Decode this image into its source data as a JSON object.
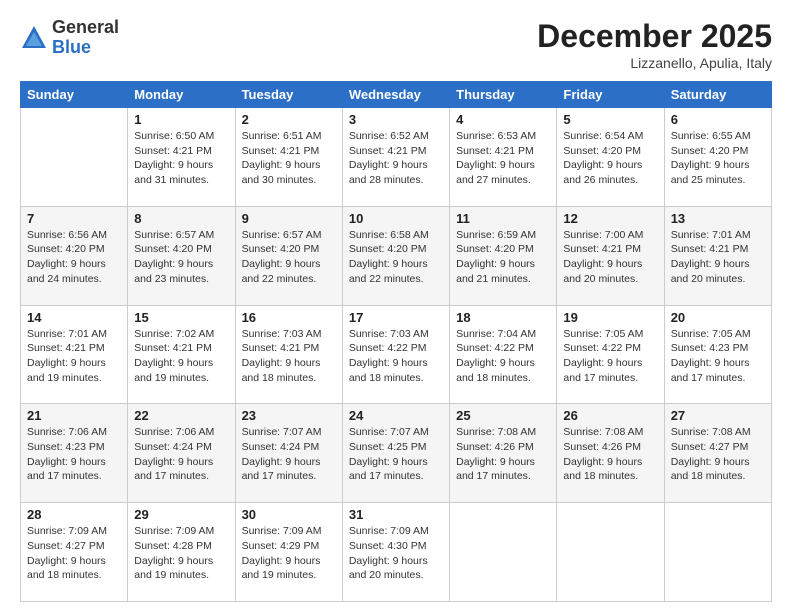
{
  "logo": {
    "general": "General",
    "blue": "Blue"
  },
  "header": {
    "month": "December 2025",
    "location": "Lizzanello, Apulia, Italy"
  },
  "weekdays": [
    "Sunday",
    "Monday",
    "Tuesday",
    "Wednesday",
    "Thursday",
    "Friday",
    "Saturday"
  ],
  "weeks": [
    [
      {
        "day": "",
        "info": ""
      },
      {
        "day": "1",
        "info": "Sunrise: 6:50 AM\nSunset: 4:21 PM\nDaylight: 9 hours\nand 31 minutes."
      },
      {
        "day": "2",
        "info": "Sunrise: 6:51 AM\nSunset: 4:21 PM\nDaylight: 9 hours\nand 30 minutes."
      },
      {
        "day": "3",
        "info": "Sunrise: 6:52 AM\nSunset: 4:21 PM\nDaylight: 9 hours\nand 28 minutes."
      },
      {
        "day": "4",
        "info": "Sunrise: 6:53 AM\nSunset: 4:21 PM\nDaylight: 9 hours\nand 27 minutes."
      },
      {
        "day": "5",
        "info": "Sunrise: 6:54 AM\nSunset: 4:20 PM\nDaylight: 9 hours\nand 26 minutes."
      },
      {
        "day": "6",
        "info": "Sunrise: 6:55 AM\nSunset: 4:20 PM\nDaylight: 9 hours\nand 25 minutes."
      }
    ],
    [
      {
        "day": "7",
        "info": "Sunrise: 6:56 AM\nSunset: 4:20 PM\nDaylight: 9 hours\nand 24 minutes."
      },
      {
        "day": "8",
        "info": "Sunrise: 6:57 AM\nSunset: 4:20 PM\nDaylight: 9 hours\nand 23 minutes."
      },
      {
        "day": "9",
        "info": "Sunrise: 6:57 AM\nSunset: 4:20 PM\nDaylight: 9 hours\nand 22 minutes."
      },
      {
        "day": "10",
        "info": "Sunrise: 6:58 AM\nSunset: 4:20 PM\nDaylight: 9 hours\nand 22 minutes."
      },
      {
        "day": "11",
        "info": "Sunrise: 6:59 AM\nSunset: 4:20 PM\nDaylight: 9 hours\nand 21 minutes."
      },
      {
        "day": "12",
        "info": "Sunrise: 7:00 AM\nSunset: 4:21 PM\nDaylight: 9 hours\nand 20 minutes."
      },
      {
        "day": "13",
        "info": "Sunrise: 7:01 AM\nSunset: 4:21 PM\nDaylight: 9 hours\nand 20 minutes."
      }
    ],
    [
      {
        "day": "14",
        "info": "Sunrise: 7:01 AM\nSunset: 4:21 PM\nDaylight: 9 hours\nand 19 minutes."
      },
      {
        "day": "15",
        "info": "Sunrise: 7:02 AM\nSunset: 4:21 PM\nDaylight: 9 hours\nand 19 minutes."
      },
      {
        "day": "16",
        "info": "Sunrise: 7:03 AM\nSunset: 4:21 PM\nDaylight: 9 hours\nand 18 minutes."
      },
      {
        "day": "17",
        "info": "Sunrise: 7:03 AM\nSunset: 4:22 PM\nDaylight: 9 hours\nand 18 minutes."
      },
      {
        "day": "18",
        "info": "Sunrise: 7:04 AM\nSunset: 4:22 PM\nDaylight: 9 hours\nand 18 minutes."
      },
      {
        "day": "19",
        "info": "Sunrise: 7:05 AM\nSunset: 4:22 PM\nDaylight: 9 hours\nand 17 minutes."
      },
      {
        "day": "20",
        "info": "Sunrise: 7:05 AM\nSunset: 4:23 PM\nDaylight: 9 hours\nand 17 minutes."
      }
    ],
    [
      {
        "day": "21",
        "info": "Sunrise: 7:06 AM\nSunset: 4:23 PM\nDaylight: 9 hours\nand 17 minutes."
      },
      {
        "day": "22",
        "info": "Sunrise: 7:06 AM\nSunset: 4:24 PM\nDaylight: 9 hours\nand 17 minutes."
      },
      {
        "day": "23",
        "info": "Sunrise: 7:07 AM\nSunset: 4:24 PM\nDaylight: 9 hours\nand 17 minutes."
      },
      {
        "day": "24",
        "info": "Sunrise: 7:07 AM\nSunset: 4:25 PM\nDaylight: 9 hours\nand 17 minutes."
      },
      {
        "day": "25",
        "info": "Sunrise: 7:08 AM\nSunset: 4:26 PM\nDaylight: 9 hours\nand 17 minutes."
      },
      {
        "day": "26",
        "info": "Sunrise: 7:08 AM\nSunset: 4:26 PM\nDaylight: 9 hours\nand 18 minutes."
      },
      {
        "day": "27",
        "info": "Sunrise: 7:08 AM\nSunset: 4:27 PM\nDaylight: 9 hours\nand 18 minutes."
      }
    ],
    [
      {
        "day": "28",
        "info": "Sunrise: 7:09 AM\nSunset: 4:27 PM\nDaylight: 9 hours\nand 18 minutes."
      },
      {
        "day": "29",
        "info": "Sunrise: 7:09 AM\nSunset: 4:28 PM\nDaylight: 9 hours\nand 19 minutes."
      },
      {
        "day": "30",
        "info": "Sunrise: 7:09 AM\nSunset: 4:29 PM\nDaylight: 9 hours\nand 19 minutes."
      },
      {
        "day": "31",
        "info": "Sunrise: 7:09 AM\nSunset: 4:30 PM\nDaylight: 9 hours\nand 20 minutes."
      },
      {
        "day": "",
        "info": ""
      },
      {
        "day": "",
        "info": ""
      },
      {
        "day": "",
        "info": ""
      }
    ]
  ]
}
